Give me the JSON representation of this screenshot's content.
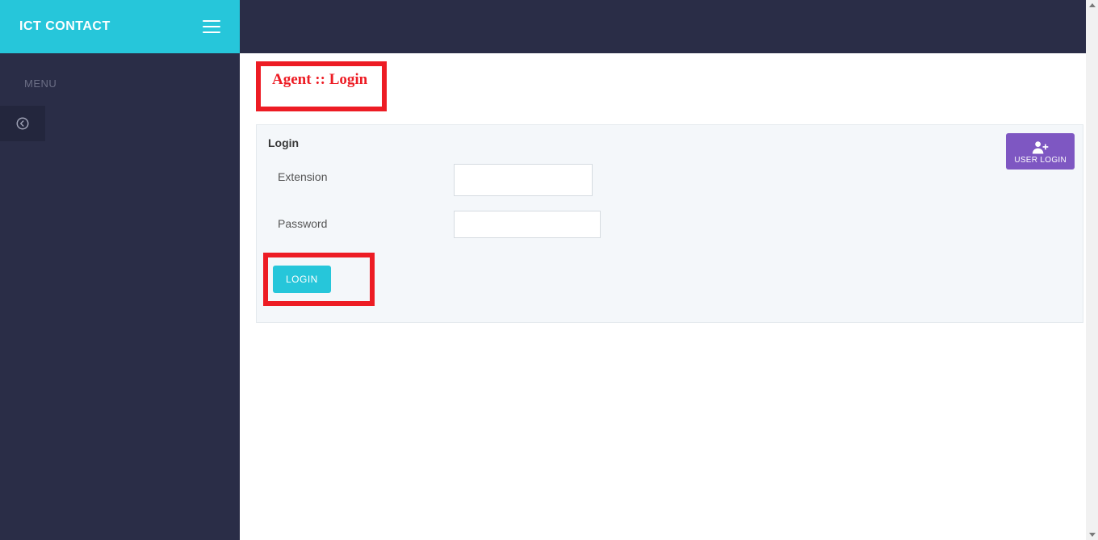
{
  "brand": {
    "title": "ICT CONTACT"
  },
  "sidebar": {
    "menu_label": "MENU"
  },
  "page": {
    "title": "Agent :: Login"
  },
  "panel": {
    "heading": "Login",
    "user_login_label": "USER LOGIN",
    "extension_label": "Extension",
    "password_label": "Password",
    "login_button": "LOGIN"
  }
}
